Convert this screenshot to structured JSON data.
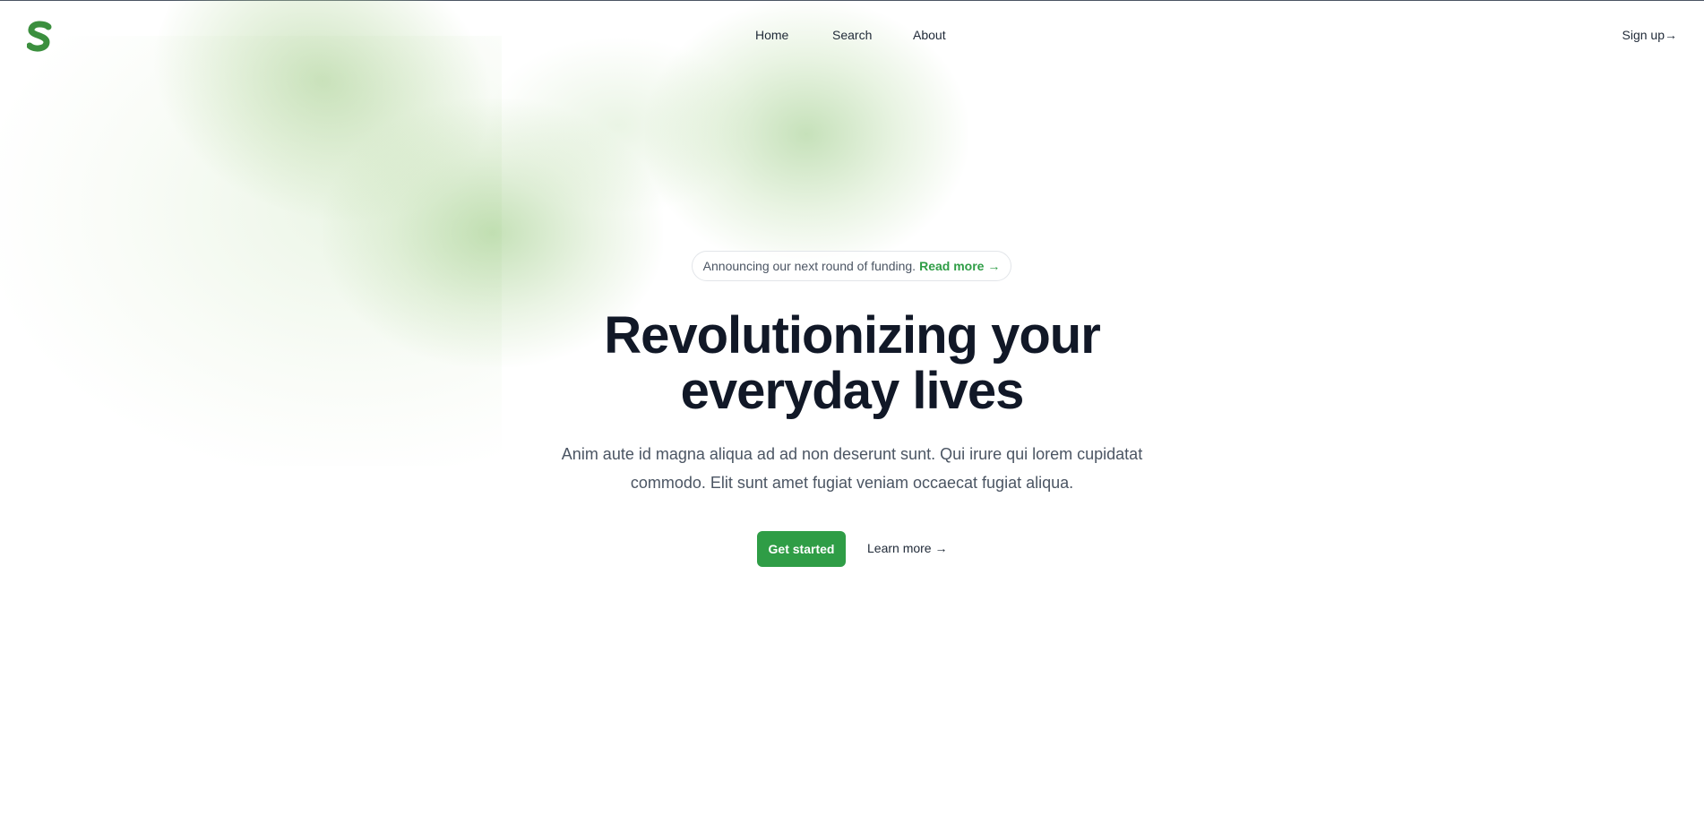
{
  "brand": {
    "logo_letter": "S",
    "accent_color": "#2f9d46",
    "logo_color": "#3b8f3e"
  },
  "nav": {
    "items": [
      {
        "label": "Home"
      },
      {
        "label": "Search"
      },
      {
        "label": "About"
      }
    ],
    "signup_label": "Sign up→"
  },
  "announcement": {
    "text": "Announcing our next round of funding.",
    "link_label": "Read more →"
  },
  "hero": {
    "headline_line1": "Revolutionizing your",
    "headline_line2": "everyday lives",
    "subtext_line1": "Anim aute id magna aliqua ad ad non deserunt sunt. Qui irure qui lorem cupidatat",
    "subtext_line2": "commodo. Elit sunt amet fugiat veniam occaecat fugiat aliqua.",
    "primary_button": "Get started",
    "secondary_link": "Learn more →"
  }
}
